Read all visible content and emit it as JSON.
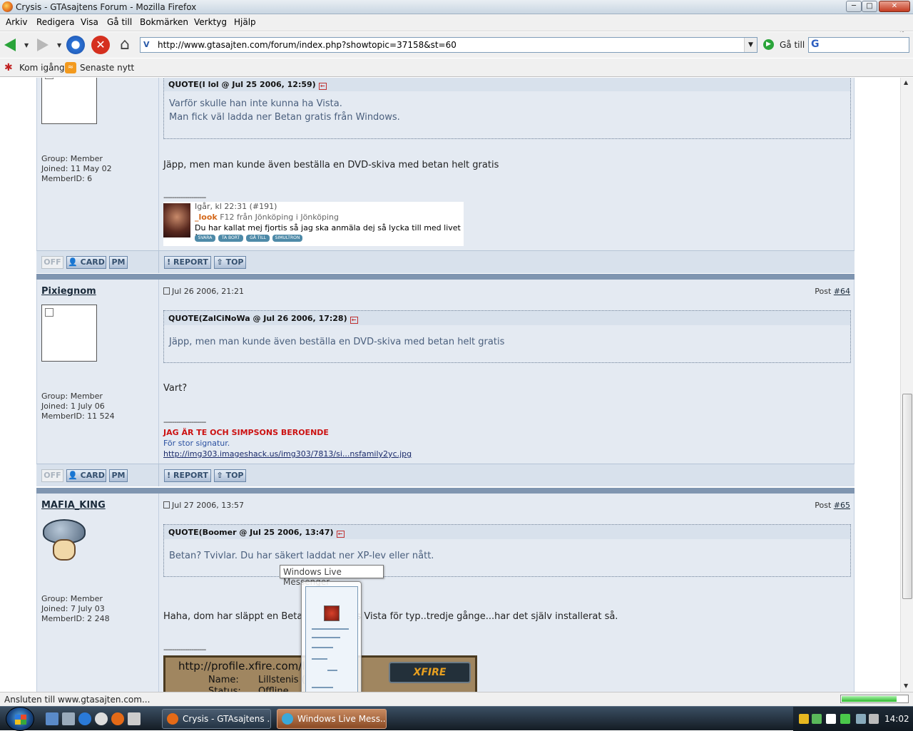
{
  "window": {
    "title": "Crysis - GTAsajtens Forum - Mozilla Firefox",
    "min": "─",
    "max": "□",
    "close": "✕"
  },
  "menu": [
    "Arkiv",
    "Redigera",
    "Visa",
    "Gå till",
    "Bokmärken",
    "Verktyg",
    "Hjälp"
  ],
  "nav": {
    "url": "http://www.gtasajten.com/forum/index.php?showtopic=37158&st=60",
    "go_label": "Gå till",
    "search_value": ""
  },
  "bookmarks": [
    "Kom igång",
    "Senaste nytt"
  ],
  "buttons": {
    "off": "OFF",
    "card": "CARD",
    "pm": "PM",
    "report": "REPORT",
    "top": "TOP"
  },
  "posts": [
    {
      "author": "",
      "quote_header": "QUOTE(I lol @ Jul 25 2006, 12:59)",
      "quote_lines": [
        "Varför skulle han inte kunna ha Vista.",
        "Man fick väl ladda ner Betan gratis från Windows."
      ],
      "group": "Group: Member",
      "joined": "Joined: 11 May 02",
      "memberid": "MemberID: 6",
      "body": "Jäpp, men man kunde även beställa en DVD-skiva med betan helt gratis",
      "sigline": "--------------------",
      "sig": {
        "l1": "Igår, kl 22:31 (#191)",
        "l2_name": "_look",
        "l2_rest": " F12 från Jönköping i Jönköping",
        "l3": "Du har kallat mej fjortis så jag ska anmäla dej så lycka till med livet !",
        "tags": [
          "SVARA",
          "TA BORT",
          "GÅ TILL",
          "SIMULTRON"
        ]
      }
    },
    {
      "author": "Pixiegnom",
      "date": "Jul 26 2006, 21:21",
      "post_label": "Post",
      "post_num": "#64",
      "quote_header": "QUOTE(ZalCiNoWa @ Jul 26 2006, 17:28)",
      "quote_lines": [
        "Jäpp, men man kunde även beställa en DVD-skiva med betan helt gratis"
      ],
      "group": "Group: Member",
      "joined": "Joined: 1 July 06",
      "memberid": "MemberID: 11 524",
      "body": "Vart?",
      "sigline": "--------------------",
      "sig_red": "JAG ÄR TE OCH SIMPSONS BEROENDE",
      "sig_blue": "För stor signatur.",
      "sig_link": "http://img303.imageshack.us/img303/7813/si...nsfamily2yc.jpg"
    },
    {
      "author": "MAFIA_KING",
      "date": "Jul 27 2006, 13:57",
      "post_label": "Post",
      "post_num": "#65",
      "quote_header": "QUOTE(Boomer @ Jul 25 2006, 13:47)",
      "quote_lines": [
        "Betan? Tvivlar. Du har säkert laddat ner XP-lev eller nått."
      ],
      "group": "Group: Member",
      "joined": "Joined: 7 July 03",
      "memberid": "MemberID: 2 248",
      "body": "Haha, dom har släppt en Beta av Windows Vista för typ..tredje gånge...har det själv installerat så.",
      "sigline": "--------------------",
      "xfire": {
        "url": "http://profile.xfire.com/lillst",
        "name_label": "Name:",
        "name_value": "Lillstenis (li",
        "status_label": "Status:",
        "status_value": "Offline",
        "logo": "XFIRE"
      }
    }
  ],
  "tooltip": "Windows Live Messenger",
  "status": {
    "text": "Ansluten till www.gtasajten.com...",
    "progress": 0.82
  },
  "taskbar": {
    "items": [
      "Crysis - GTAsajtens ...",
      "Windows Live Mess..."
    ],
    "clock": "14:02"
  }
}
